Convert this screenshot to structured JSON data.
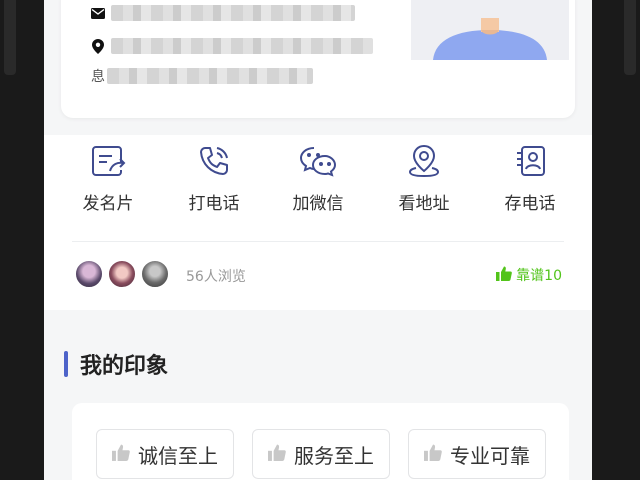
{
  "contact": {
    "address_prefix": "息",
    "email_icon": "envelope-icon",
    "location_icon": "location-pin-icon"
  },
  "actions": [
    {
      "label": "发名片",
      "icon": "send-card-icon"
    },
    {
      "label": "打电话",
      "icon": "phone-call-icon"
    },
    {
      "label": "加微信",
      "icon": "wechat-icon"
    },
    {
      "label": "看地址",
      "icon": "map-pin-icon"
    },
    {
      "label": "存电话",
      "icon": "save-contact-icon"
    }
  ],
  "viewers": {
    "count_text": "56人浏览",
    "likes_text": "靠谱10"
  },
  "impression": {
    "title": "我的印象",
    "tags": [
      "诚信至上",
      "服务至上",
      "专业可靠"
    ]
  },
  "colors": {
    "accent": "#4d63c9",
    "like_green": "#52c41a",
    "icon_blue": "#3f4b8f"
  }
}
